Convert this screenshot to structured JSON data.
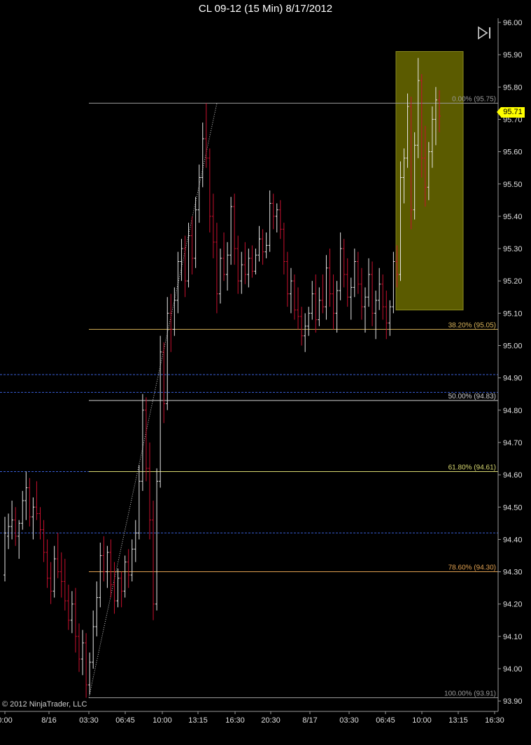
{
  "window": {
    "title": "CL 09-12 (15 Min)  8/17/2012"
  },
  "copyright": "© 2012 NinjaTrader, LLC",
  "last_price": "95.71",
  "colors": {
    "background": "#000000",
    "up_bar": "#e8e8e8",
    "down_bar": "#c8102e",
    "highlight_box": "#6b6b00",
    "fib_line_gold": "#d8b35a",
    "fib_line_orange": "#e0a050",
    "fib_line_gray": "#9a9a9a",
    "dash_line": "#3a5fd8",
    "last_price_tag": "#ffff00"
  },
  "icons": {
    "nav": "skip-to-end-icon"
  },
  "chart_data": {
    "type": "ohlc",
    "title": "CL 09-12 (15 Min)  8/17/2012",
    "ylim": [
      93.82,
      96.0
    ],
    "y_ticks": [
      "96.00",
      "95.90",
      "95.80",
      "95.70",
      "95.60",
      "95.50",
      "95.40",
      "95.30",
      "95.20",
      "95.10",
      "95.00",
      "94.90",
      "94.80",
      "94.70",
      "94.60",
      "94.50",
      "94.40",
      "94.30",
      "94.20",
      "94.10",
      "94.00",
      "93.90"
    ],
    "x_ticks": [
      "0:00",
      "8/16",
      "03:30",
      "06:45",
      "10:00",
      "13:15",
      "16:30",
      "20:30",
      "8/17",
      "03:30",
      "06:45",
      "10:00",
      "13:15",
      "16:30"
    ],
    "fibonacci": [
      {
        "label": "0.00% (95.75)",
        "price": 95.75,
        "color": "#9a9a9a"
      },
      {
        "label": "38.20% (95.05)",
        "price": 95.05,
        "color": "#d8b35a"
      },
      {
        "label": "50.00% (94.83)",
        "price": 94.83,
        "color": "#cfcfcf"
      },
      {
        "label": "61.80% (94.61)",
        "price": 94.61,
        "color": "#d8d870"
      },
      {
        "label": "78.60% (94.30)",
        "price": 94.3,
        "color": "#e0a050"
      },
      {
        "label": "100.00% (93.91)",
        "price": 93.91,
        "color": "#9a9a9a"
      }
    ],
    "horizontal_lines": [
      94.91,
      94.855,
      94.61,
      94.42
    ],
    "highlight_box": {
      "bar_from": 126,
      "bar_to": 148,
      "price_low": 95.11,
      "price_high": 95.91
    },
    "bars": [
      [
        94.29,
        94.47,
        94.27,
        94.42
      ],
      [
        94.41,
        94.48,
        94.37,
        94.44
      ],
      [
        94.44,
        94.52,
        94.4,
        94.46
      ],
      [
        94.46,
        94.5,
        94.38,
        94.41
      ],
      [
        94.41,
        94.46,
        94.34,
        94.45
      ],
      [
        94.45,
        94.55,
        94.43,
        94.52
      ],
      [
        94.52,
        94.61,
        94.46,
        94.56
      ],
      [
        94.56,
        94.59,
        94.44,
        94.47
      ],
      [
        94.47,
        94.53,
        94.4,
        94.5
      ],
      [
        94.5,
        94.58,
        94.46,
        94.48
      ],
      [
        94.48,
        94.5,
        94.4,
        94.43
      ],
      [
        94.43,
        94.46,
        94.33,
        94.36
      ],
      [
        94.36,
        94.4,
        94.25,
        94.28
      ],
      [
        94.28,
        94.33,
        94.2,
        94.24
      ],
      [
        94.24,
        94.38,
        94.22,
        94.34
      ],
      [
        94.34,
        94.42,
        94.28,
        94.3
      ],
      [
        94.3,
        94.36,
        94.22,
        94.27
      ],
      [
        94.27,
        94.34,
        94.18,
        94.21
      ],
      [
        94.21,
        94.26,
        94.12,
        94.15
      ],
      [
        94.15,
        94.24,
        94.11,
        94.2
      ],
      [
        94.2,
        94.25,
        94.05,
        94.1
      ],
      [
        94.1,
        94.14,
        93.99,
        94.03
      ],
      [
        94.03,
        94.12,
        93.98,
        94.08
      ],
      [
        94.08,
        94.11,
        93.91,
        93.95
      ],
      [
        93.95,
        94.05,
        93.92,
        94.02
      ],
      [
        94.02,
        94.18,
        94.0,
        94.13
      ],
      [
        94.13,
        94.27,
        94.1,
        94.22
      ],
      [
        94.22,
        94.39,
        94.19,
        94.35
      ],
      [
        94.35,
        94.41,
        94.27,
        94.3
      ],
      [
        94.3,
        94.38,
        94.25,
        94.36
      ],
      [
        94.36,
        94.4,
        94.22,
        94.26
      ],
      [
        94.26,
        94.33,
        94.17,
        94.21
      ],
      [
        94.21,
        94.31,
        94.19,
        94.28
      ],
      [
        94.28,
        94.3,
        94.19,
        94.24
      ],
      [
        94.24,
        94.35,
        94.22,
        94.33
      ],
      [
        94.33,
        94.37,
        94.25,
        94.29
      ],
      [
        94.29,
        94.4,
        94.27,
        94.37
      ],
      [
        94.37,
        94.46,
        94.33,
        94.42
      ],
      [
        94.42,
        94.63,
        94.4,
        94.58
      ],
      [
        94.58,
        94.85,
        94.55,
        94.8
      ],
      [
        94.8,
        94.84,
        94.58,
        94.62
      ],
      [
        94.62,
        94.7,
        94.4,
        94.46
      ],
      [
        94.46,
        94.52,
        94.15,
        94.2
      ],
      [
        94.2,
        94.62,
        94.18,
        94.58
      ],
      [
        94.58,
        95.03,
        94.56,
        94.98
      ],
      [
        94.98,
        95.01,
        94.76,
        94.82
      ],
      [
        94.82,
        95.15,
        94.8,
        95.1
      ],
      [
        95.1,
        95.16,
        94.98,
        95.05
      ],
      [
        95.05,
        95.18,
        95.03,
        95.14
      ],
      [
        95.14,
        95.29,
        95.1,
        95.26
      ],
      [
        95.26,
        95.33,
        95.2,
        95.3
      ],
      [
        95.3,
        95.34,
        95.15,
        95.2
      ],
      [
        95.2,
        95.38,
        95.18,
        95.34
      ],
      [
        95.34,
        95.4,
        95.22,
        95.27
      ],
      [
        95.27,
        95.46,
        95.24,
        95.42
      ],
      [
        95.42,
        95.56,
        95.38,
        95.52
      ],
      [
        95.52,
        95.69,
        95.49,
        95.64
      ],
      [
        95.64,
        95.75,
        95.55,
        95.58
      ],
      [
        95.58,
        95.61,
        95.35,
        95.4
      ],
      [
        95.4,
        95.47,
        95.27,
        95.32
      ],
      [
        95.32,
        95.38,
        95.1,
        95.16
      ],
      [
        95.16,
        95.3,
        95.13,
        95.27
      ],
      [
        95.27,
        95.35,
        95.2,
        95.22
      ],
      [
        95.22,
        95.32,
        95.17,
        95.28
      ],
      [
        95.28,
        95.46,
        95.25,
        95.43
      ],
      [
        95.43,
        95.47,
        95.25,
        95.3
      ],
      [
        95.3,
        95.34,
        95.16,
        95.2
      ],
      [
        95.2,
        95.29,
        95.16,
        95.25
      ],
      [
        95.25,
        95.32,
        95.19,
        95.22
      ],
      [
        95.22,
        95.3,
        95.18,
        95.27
      ],
      [
        95.27,
        95.31,
        95.21,
        95.23
      ],
      [
        95.23,
        95.3,
        95.22,
        95.28
      ],
      [
        95.28,
        95.37,
        95.26,
        95.33
      ],
      [
        95.33,
        95.36,
        95.25,
        95.29
      ],
      [
        95.29,
        95.35,
        95.27,
        95.31
      ],
      [
        95.31,
        95.48,
        95.29,
        95.44
      ],
      [
        95.44,
        95.47,
        95.36,
        95.4
      ],
      [
        95.4,
        95.44,
        95.35,
        95.42
      ],
      [
        95.42,
        95.45,
        95.33,
        95.36
      ],
      [
        95.36,
        95.38,
        95.22,
        95.26
      ],
      [
        95.26,
        95.29,
        95.12,
        95.16
      ],
      [
        95.16,
        95.24,
        95.1,
        95.2
      ],
      [
        95.2,
        95.22,
        95.08,
        95.11
      ],
      [
        95.11,
        95.18,
        95.05,
        95.09
      ],
      [
        95.09,
        95.12,
        95.0,
        95.03
      ],
      [
        95.03,
        95.1,
        94.98,
        95.06
      ],
      [
        95.06,
        95.12,
        95.03,
        95.1
      ],
      [
        95.1,
        95.2,
        95.08,
        95.16
      ],
      [
        95.16,
        95.22,
        95.04,
        95.08
      ],
      [
        95.08,
        95.18,
        95.06,
        95.14
      ],
      [
        95.14,
        95.22,
        95.1,
        95.12
      ],
      [
        95.12,
        95.28,
        95.08,
        95.24
      ],
      [
        95.24,
        95.3,
        95.12,
        95.16
      ],
      [
        95.16,
        95.22,
        95.05,
        95.1
      ],
      [
        95.1,
        95.2,
        95.04,
        95.17
      ],
      [
        95.17,
        95.35,
        95.14,
        95.3
      ],
      [
        95.3,
        95.33,
        95.18,
        95.22
      ],
      [
        95.22,
        95.27,
        95.12,
        95.15
      ],
      [
        95.15,
        95.21,
        95.08,
        95.18
      ],
      [
        95.18,
        95.3,
        95.15,
        95.26
      ],
      [
        95.26,
        95.29,
        95.16,
        95.19
      ],
      [
        95.19,
        95.24,
        95.08,
        95.12
      ],
      [
        95.12,
        95.18,
        95.04,
        95.15
      ],
      [
        95.15,
        95.27,
        95.12,
        95.22
      ],
      [
        95.22,
        95.26,
        95.06,
        95.1
      ],
      [
        95.1,
        95.17,
        95.02,
        95.14
      ],
      [
        95.14,
        95.24,
        95.11,
        95.19
      ],
      [
        95.19,
        95.22,
        95.08,
        95.12
      ],
      [
        95.12,
        95.17,
        95.02,
        95.07
      ],
      [
        95.07,
        95.14,
        95.03,
        95.12
      ],
      [
        95.12,
        95.29,
        95.1,
        95.26
      ],
      [
        95.26,
        95.31,
        95.18,
        95.22
      ],
      [
        95.22,
        95.57,
        95.2,
        95.52
      ],
      [
        95.52,
        95.61,
        95.44,
        95.58
      ],
      [
        95.58,
        95.78,
        95.55,
        95.74
      ],
      [
        95.74,
        95.77,
        95.36,
        95.42
      ],
      [
        95.42,
        95.66,
        95.39,
        95.62
      ],
      [
        95.62,
        95.89,
        95.58,
        95.82
      ],
      [
        95.82,
        95.84,
        95.52,
        95.58
      ],
      [
        95.58,
        95.68,
        95.43,
        95.49
      ],
      [
        95.49,
        95.63,
        95.45,
        95.6
      ],
      [
        95.6,
        95.74,
        95.55,
        95.7
      ],
      [
        95.7,
        95.8,
        95.62,
        95.76
      ],
      [
        95.76,
        95.79,
        95.66,
        95.71
      ]
    ]
  }
}
